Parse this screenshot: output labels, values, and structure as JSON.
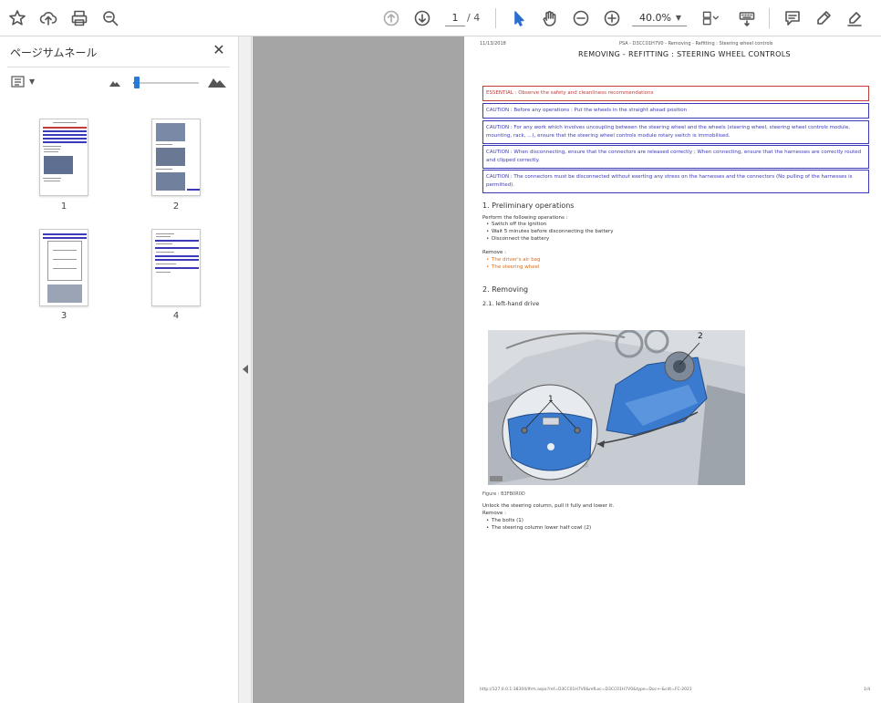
{
  "toolbar": {
    "page_current": "1",
    "page_total": "/ 4",
    "zoom": "40.0%"
  },
  "sidebar": {
    "title": "ページサムネール",
    "close": "✕",
    "thumbnails": [
      {
        "label": "1"
      },
      {
        "label": "2"
      },
      {
        "label": "3"
      },
      {
        "label": "4"
      }
    ]
  },
  "document": {
    "date": "11/13/2018",
    "header": "PSA - D3CC01H7V0 - Removing - Refitting : Steering wheel controls",
    "title": "REMOVING - REFITTING : STEERING WHEEL CONTROLS",
    "essential": "ESSENTIAL : Observe the safety and cleanliness recommendations",
    "cautions": [
      "CAUTION : Before any operations : Put the wheels in the straight ahead position",
      "CAUTION : For any work which involves uncoupling between the steering wheel and the wheels (steering wheel, steering wheel controls module, mounting, rack, ...), ensure that the steering wheel controls module rotary switch is immobilised.",
      "CAUTION : When disconnecting, ensure that the connectors are released correctly ; When connecting, ensure that the harnesses are correctly routed and clipped correctly.",
      "CAUTION : The connectors must be disconnected without exerting any stress on the harnesses and the connectors (No pulling of the harnesses is permitted)."
    ],
    "section1_title": "1. Preliminary operations",
    "section1_intro": "Perform the following operations :",
    "section1_items": [
      "Switch off the ignition",
      "Wait 5 minutes before disconnecting the battery",
      "Disconnect the battery"
    ],
    "remove_label": "Remove :",
    "remove_items": [
      "The driver's air bag",
      "The steering wheel"
    ],
    "section2_title": "2. Removing",
    "section2_sub": "2.1. left-hand drive",
    "figure_callout_1": "1",
    "figure_callout_2": "2",
    "figure_caption": "Figure : B3FB0R0D",
    "after_text": "Unlock the steering column, pull it fully and lower it.",
    "remove2_label": "Remove :",
    "remove2_items": [
      "The bolts (1)",
      "The steering column lower half cowl (2)"
    ],
    "footer_url": "http://127.0.0.1:38304/Ifrm.aspx?ref=D3CC01H7V0&refLoc=D3CC01H7V0&type=Doc+-&cdt=FC-2021",
    "footer_page": "1/4"
  }
}
